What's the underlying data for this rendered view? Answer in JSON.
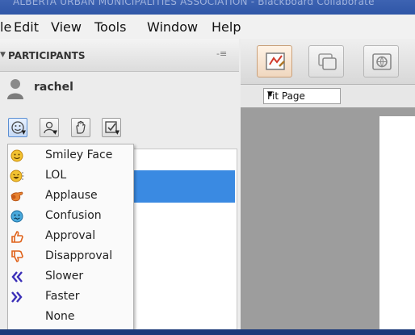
{
  "window": {
    "title": "ALBERTA URBAN MUNICIPALITIES ASSOCIATION - Blackboard Collaborate"
  },
  "menubar": {
    "items": [
      "le",
      "Edit",
      "View",
      "Tools",
      "Window",
      "Help"
    ]
  },
  "participants_panel": {
    "title": "PARTICIPANTS",
    "collapse_icon": "triangle-down-icon",
    "minimize_icon": "minimize-icon",
    "user": {
      "name": "rachel",
      "avatar_icon": "user-silhouette-icon"
    },
    "toolbar": {
      "buttons": [
        "smiley-emoticon-icon",
        "user-profile-icon",
        "raise-hand-icon",
        "checkbox-poll-icon"
      ]
    },
    "emoticon_menu": {
      "items": [
        {
          "label": "Smiley Face",
          "icon": "smiley-face-icon",
          "color": "#e8b020"
        },
        {
          "label": "LOL",
          "icon": "lol-face-icon",
          "color": "#e8b020"
        },
        {
          "label": "Applause",
          "icon": "applause-hands-icon",
          "color": "#e87a1e"
        },
        {
          "label": "Confusion",
          "icon": "confusion-face-icon",
          "color": "#3fa6d8"
        },
        {
          "label": "Approval",
          "icon": "thumbs-up-icon",
          "color": "#e66a1c"
        },
        {
          "label": "Disapproval",
          "icon": "thumbs-down-icon",
          "color": "#e66a1c"
        },
        {
          "label": "Slower",
          "icon": "double-chevron-left-icon",
          "color": "#3a2fb5"
        },
        {
          "label": "Faster",
          "icon": "double-chevron-right-icon",
          "color": "#3a2fb5"
        },
        {
          "label": "None",
          "icon": "",
          "color": ""
        }
      ]
    }
  },
  "whiteboard": {
    "tools": [
      "whiteboard-icon",
      "application-share-icon",
      "web-tour-icon"
    ],
    "zoom": {
      "value": "Fit Page",
      "caret_icon": "caret-down-icon"
    }
  },
  "colors": {
    "selection": "#3a8ae2",
    "window_chrome": "#2f56a7"
  }
}
